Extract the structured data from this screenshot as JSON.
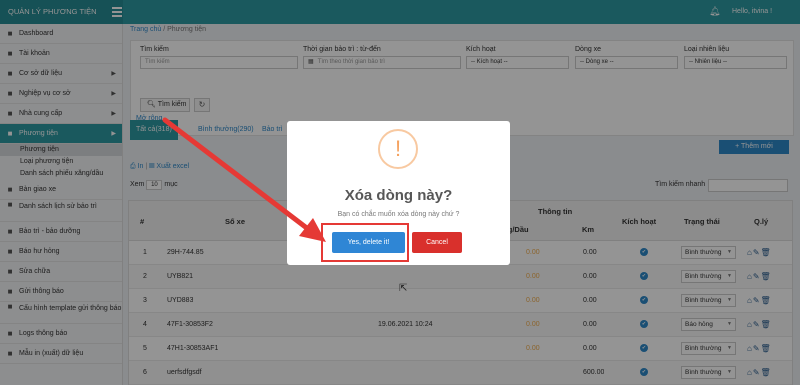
{
  "app": {
    "title": "QUẢN LÝ PHƯƠNG TIỆN",
    "user_greeting": "Hello, itvina !"
  },
  "sidebar": {
    "items": [
      {
        "label": "Dashboard",
        "icon": "monitor-icon"
      },
      {
        "label": "Tài khoản",
        "icon": "users-icon"
      },
      {
        "label": "Cơ sở dữ liệu",
        "icon": "database-icon",
        "arrow": "▶"
      },
      {
        "label": "Nghiệp vụ cơ sở",
        "icon": "person-icon",
        "arrow": "▶"
      },
      {
        "label": "Nhà cung cấp",
        "icon": "house-icon",
        "arrow": "▶"
      },
      {
        "label": "Phương tiện",
        "icon": "car-icon",
        "arrow": "▶"
      }
    ],
    "subitems": [
      "Phương tiện",
      "Loại phương tiện",
      "Danh sách phiếu xăng/dầu"
    ],
    "items_after": [
      {
        "label": "Bàn giao xe",
        "icon": "handover-icon"
      },
      {
        "label": "Danh sách lịch sử bảo trì",
        "icon": "history-icon"
      },
      {
        "label": "Bảo trì - bảo dưỡng",
        "icon": "wrench-icon"
      },
      {
        "label": "Báo hư hỏng",
        "icon": "report-icon"
      },
      {
        "label": "Sửa chữa",
        "icon": "tools-icon"
      },
      {
        "label": "Gửi thông báo",
        "icon": "send-icon"
      },
      {
        "label": "Cấu hình template gửi thông báo",
        "icon": "settings-icon"
      },
      {
        "label": "Logs thông báo",
        "icon": "logs-icon"
      },
      {
        "label": "Mẫu in (xuất) dữ liệu",
        "icon": "print-icon"
      }
    ]
  },
  "breadcrumb": {
    "home": "Trang chủ",
    "sep": "/",
    "current": "Phương tiện"
  },
  "filter": {
    "search_label": "Tìm kiếm",
    "search_placeholder": "Tìm kiếm",
    "maint_label": "Thời gian bảo trì : từ-đến",
    "maint_placeholder": "Tìm theo thời gian bảo trì",
    "active_label": "Kích hoạt",
    "active_value": "-- Kích hoạt --",
    "line_label": "Dòng xe",
    "line_value": "-- Dòng xe --",
    "fuel_label": "Loại nhiên liệu",
    "fuel_value": "-- Nhiên liệu --",
    "search_button": "Tìm kiếm",
    "more_link": "Mở rộng..."
  },
  "tabs": [
    "Tất cả(318)",
    "Bình thường(290)",
    "Bảo trì"
  ],
  "add_button": "+ Thêm mới",
  "tools": {
    "print": "In",
    "sep": "|",
    "excel": "Xuất excel"
  },
  "view": {
    "prefix": "Xem",
    "size": "10",
    "suffix": "mục"
  },
  "quick_search_label": "Tìm kiếm nhanh",
  "table": {
    "headers": {
      "index": "#",
      "plate": "Số xe",
      "info": "Thông tin",
      "fuel": "Xăng/Dầu",
      "km": "Km",
      "active": "Kích hoạt",
      "status": "Trạng thái",
      "manage": "Q.lý"
    },
    "rows": [
      {
        "no": "1",
        "plate": "29H-744.85",
        "date": "",
        "fuel": "0.00",
        "km": "0.00",
        "status": "Bình thường"
      },
      {
        "no": "2",
        "plate": "UYB821",
        "date": "",
        "fuel": "0.00",
        "km": "0.00",
        "status": "Bình thường"
      },
      {
        "no": "3",
        "plate": "UYD883",
        "date": "",
        "fuel": "0.00",
        "km": "0.00",
        "status": "Bình thường"
      },
      {
        "no": "4",
        "plate": "47F1-30853F2",
        "date": "19.06.2021 10:24",
        "fuel": "0.00",
        "km": "0.00",
        "status": "Báo hỏng"
      },
      {
        "no": "5",
        "plate": "47H1-30853AF1",
        "date": "",
        "fuel": "0.00",
        "km": "0.00",
        "status": "Bình thường"
      },
      {
        "no": "6",
        "plate": "uerfsdfgsdf",
        "date": "",
        "fuel": "",
        "km": "600.00",
        "status": "Bình thường"
      }
    ]
  },
  "modal": {
    "icon_symbol": "!",
    "title": "Xóa dòng này?",
    "text": "Bạn có chắc muốn xóa dòng này chứ ?",
    "confirm": "Yes, delete it!",
    "cancel": "Cancel"
  },
  "colors": {
    "primary": "#2e9aa3",
    "link": "#2e88c9",
    "danger": "#d9302c",
    "confirm": "#2f86d5",
    "annotation": "#e53935"
  }
}
